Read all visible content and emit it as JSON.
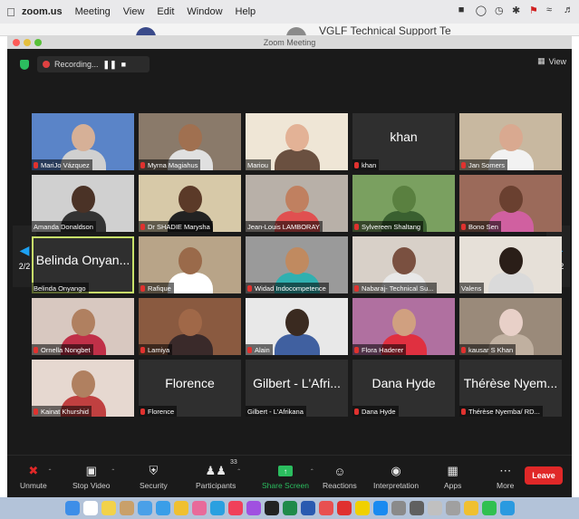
{
  "menubar": {
    "app_name": "zoom.us",
    "items": [
      "Meeting",
      "View",
      "Edit",
      "Window",
      "Help"
    ]
  },
  "background_window": {
    "title": "VGLF Technical Support Te"
  },
  "window": {
    "title": "Zoom Meeting"
  },
  "recording": {
    "label": "Recording...",
    "pause": "❚❚",
    "stop": "■"
  },
  "view_button": {
    "label": "View"
  },
  "pagination": {
    "left_label": "2/2",
    "right_label": "2/2"
  },
  "participants": [
    {
      "name": "MariJo Vázquez",
      "muted": true,
      "video": true,
      "bg": "#5a84c8",
      "skin": "#d6b097",
      "shirt": "#d0d0d0"
    },
    {
      "name": "Myrna Magiahus",
      "muted": true,
      "video": true,
      "bg": "#8a7a6a",
      "skin": "#a07050",
      "shirt": "#e0e0e0"
    },
    {
      "name": "Mariou",
      "muted": false,
      "video": true,
      "bg": "#efe6d6",
      "skin": "#e3b296",
      "shirt": "#6a5040"
    },
    {
      "name": "khan",
      "muted": true,
      "video": false,
      "display": "khan"
    },
    {
      "name": "Jan Somers",
      "muted": true,
      "video": true,
      "bg": "#c8b8a0",
      "skin": "#d9a990",
      "shirt": "#f2f2f2"
    },
    {
      "name": "Amanda Donaldson",
      "muted": false,
      "video": true,
      "bg": "#d0d0d0",
      "skin": "#4a3226",
      "shirt": "#333333"
    },
    {
      "name": "Dr SHADIE Marysha",
      "muted": true,
      "video": true,
      "bg": "#d7c9a8",
      "skin": "#5b3a28",
      "shirt": "#222222"
    },
    {
      "name": "Jean-Louis LAMBORAY",
      "muted": false,
      "video": true,
      "bg": "#b8b0a8",
      "skin": "#c08060",
      "shirt": "#e05050"
    },
    {
      "name": "Sylvereen Shaltang",
      "muted": true,
      "video": true,
      "bg": "#7aa060",
      "skin": "#5a8040",
      "shirt": "#3a6030"
    },
    {
      "name": "Bono Sen",
      "muted": true,
      "video": true,
      "bg": "#9b6a5a",
      "skin": "#6a4030",
      "shirt": "#d060a0"
    },
    {
      "name": "Belinda Onyango",
      "muted": false,
      "video": false,
      "display": "Belinda Onyan...",
      "active": true
    },
    {
      "name": "Rafique",
      "muted": true,
      "video": true,
      "bg": "#b8a488",
      "skin": "#9a6a4a",
      "shirt": "#ffffff"
    },
    {
      "name": "Widad Indocompetence",
      "muted": true,
      "video": true,
      "bg": "#9a9a9a",
      "skin": "#c08a60",
      "shirt": "#30b0b0"
    },
    {
      "name": "Nabaraj- Technical Su...",
      "muted": true,
      "video": true,
      "bg": "#d8d0c8",
      "skin": "#7a5040",
      "shirt": "#e8e8e8"
    },
    {
      "name": "Valens",
      "muted": false,
      "video": true,
      "bg": "#e6e0d8",
      "skin": "#2a1e18",
      "shirt": "#dadada"
    },
    {
      "name": "Ornella Nongbet",
      "muted": true,
      "video": true,
      "bg": "#d8c8c0",
      "skin": "#b08060",
      "shirt": "#c03048"
    },
    {
      "name": "Lamiya",
      "muted": true,
      "video": true,
      "bg": "#8a5a40",
      "skin": "#a06848",
      "shirt": "#3a2a2a"
    },
    {
      "name": "Alain",
      "muted": true,
      "video": true,
      "bg": "#e8e8e8",
      "skin": "#3a2a20",
      "shirt": "#4060a0"
    },
    {
      "name": "Flora Haderer",
      "muted": true,
      "video": true,
      "bg": "#b070a0",
      "skin": "#d0a080",
      "shirt": "#e03040"
    },
    {
      "name": "kausar S Khan",
      "muted": true,
      "video": true,
      "bg": "#9a8a7a",
      "skin": "#e8d0c8",
      "shirt": "#c0b0a0"
    },
    {
      "name": "Kainat Khurshid",
      "muted": true,
      "video": true,
      "bg": "#e6d8d0",
      "skin": "#b08060",
      "shirt": "#c04040"
    },
    {
      "name": "Florence",
      "muted": true,
      "video": false,
      "display": "Florence"
    },
    {
      "name": "Gilbert - L'Afrikana",
      "muted": false,
      "video": false,
      "display": "Gilbert - L'Afri..."
    },
    {
      "name": "Dana Hyde",
      "muted": true,
      "video": false,
      "display": "Dana Hyde"
    },
    {
      "name": "Thérèse Nyemba/ RD...",
      "muted": true,
      "video": false,
      "display": "Thérèse Nyem..."
    }
  ],
  "toolbar": {
    "unmute": "Unmute",
    "stop_video": "Stop Video",
    "security": "Security",
    "participants": "Participants",
    "participants_count": "33",
    "share_screen": "Share Screen",
    "reactions": "Reactions",
    "interpretation": "Interpretation",
    "apps": "Apps",
    "more": "More",
    "leave": "Leave"
  },
  "colors": {
    "accent_green": "#2bbd5f",
    "leave_red": "#e02828",
    "active_speaker": "#c9e36a",
    "window_bg": "#1a1a1a"
  },
  "dock_icons": [
    "finder-icon",
    "calendar-icon",
    "notes-icon",
    "contacts-icon",
    "mail-icon",
    "safari-icon",
    "chrome-icon",
    "photos-icon",
    "skype-icon",
    "music-icon",
    "podcasts-icon",
    "tv-icon",
    "excel-icon",
    "word-icon",
    "app-icon",
    "opera-icon",
    "kakao-icon",
    "appstore-icon",
    "settings-icon",
    "activity-icon",
    "trash-icon",
    "question-icon",
    "chrome2-icon",
    "whatsapp-icon",
    "telegram-icon"
  ]
}
